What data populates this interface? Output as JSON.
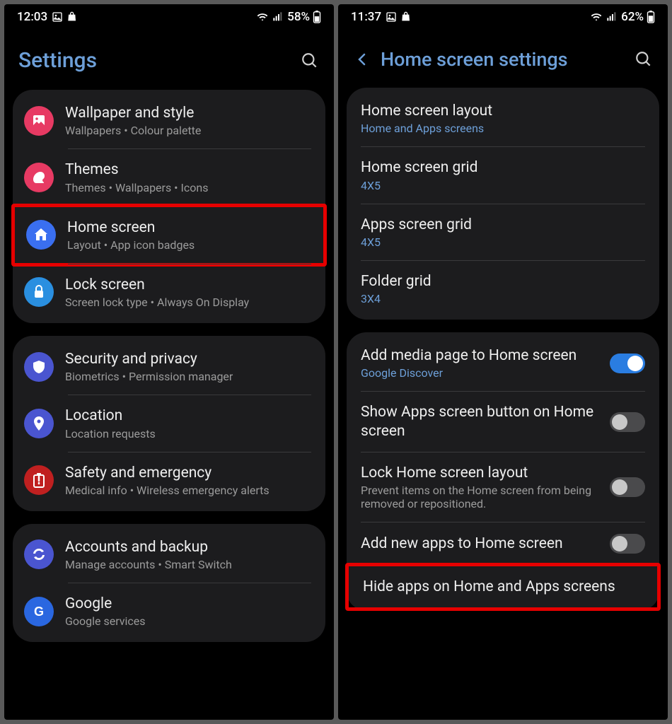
{
  "left": {
    "status": {
      "time": "12:03",
      "battery": "58%"
    },
    "title": "Settings",
    "groups": [
      {
        "items": [
          {
            "icon": "wallpaper",
            "color": "#e73a63",
            "title": "Wallpaper and style",
            "sub": "Wallpapers  •  Colour palette"
          },
          {
            "icon": "themes",
            "color": "#e73a63",
            "title": "Themes",
            "sub": "Themes  •  Wallpapers  •  Icons"
          },
          {
            "icon": "home",
            "color": "#3a6ff0",
            "title": "Home screen",
            "sub": "Layout  •  App icon badges",
            "highlight": true
          },
          {
            "icon": "lock",
            "color": "#2a8fe0",
            "title": "Lock screen",
            "sub": "Screen lock type  •  Always On Display"
          }
        ]
      },
      {
        "items": [
          {
            "icon": "shield",
            "color": "#4a55d0",
            "title": "Security and privacy",
            "sub": "Biometrics  •  Permission manager"
          },
          {
            "icon": "location",
            "color": "#4a55d0",
            "title": "Location",
            "sub": "Location requests"
          },
          {
            "icon": "emergency",
            "color": "#c02020",
            "title": "Safety and emergency",
            "sub": "Medical info  •  Wireless emergency alerts"
          }
        ]
      },
      {
        "items": [
          {
            "icon": "sync",
            "color": "#4a55d0",
            "title": "Accounts and backup",
            "sub": "Manage accounts  •  Smart Switch"
          },
          {
            "icon": "google",
            "color": "#2a67e0",
            "title": "Google",
            "sub": "Google services"
          }
        ]
      }
    ]
  },
  "right": {
    "status": {
      "time": "11:37",
      "battery": "62%"
    },
    "title": "Home screen settings",
    "groups": [
      {
        "items": [
          {
            "title": "Home screen layout",
            "sub": "Home and Apps screens",
            "subBlue": true
          },
          {
            "title": "Home screen grid",
            "sub": "4X5",
            "subBlue": true
          },
          {
            "title": "Apps screen grid",
            "sub": "4X5",
            "subBlue": true
          },
          {
            "title": "Folder grid",
            "sub": "3X4",
            "subBlue": true
          }
        ]
      },
      {
        "items": [
          {
            "title": "Add media page to Home screen",
            "sub": "Google Discover",
            "subBlue": true,
            "toggle": "on"
          },
          {
            "title": "Show Apps screen button on Home screen",
            "toggle": "off"
          },
          {
            "title": "Lock Home screen layout",
            "sub": "Prevent items on the Home screen from being removed or repositioned.",
            "toggle": "off"
          },
          {
            "title": "Add new apps to Home screen",
            "toggle": "off"
          },
          {
            "title": "Hide apps on Home and Apps screens",
            "highlight": true
          }
        ]
      }
    ]
  },
  "icons": {
    "wallpaper": "image-icon",
    "themes": "brush-icon",
    "home": "home-icon",
    "lock": "lock-icon",
    "shield": "shield-icon",
    "location": "pin-icon",
    "emergency": "alert-icon",
    "sync": "sync-icon",
    "google": "google-icon"
  }
}
